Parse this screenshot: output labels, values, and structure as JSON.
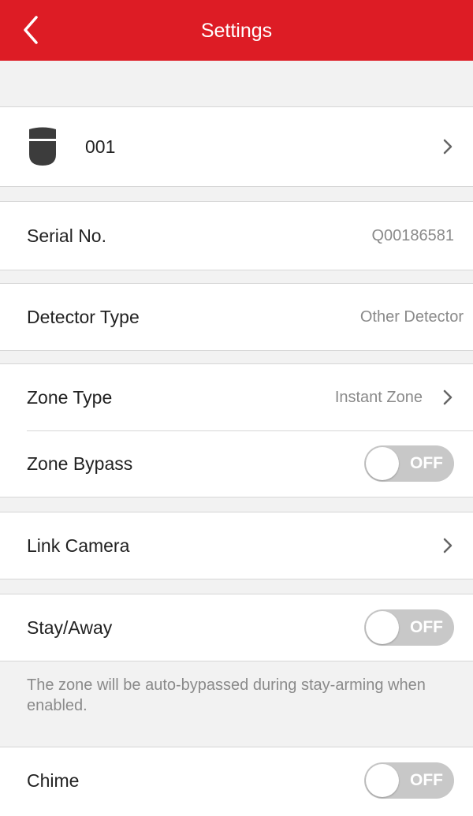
{
  "header": {
    "title": "Settings"
  },
  "device": {
    "name": "001",
    "icon": "detector-icon"
  },
  "serial": {
    "label": "Serial No.",
    "value": "Q00186581"
  },
  "detector_type": {
    "label": "Detector Type",
    "value": "Other Detector"
  },
  "zone_type": {
    "label": "Zone Type",
    "value": "Instant Zone"
  },
  "zone_bypass": {
    "label": "Zone Bypass",
    "state": "OFF"
  },
  "link_camera": {
    "label": "Link Camera"
  },
  "stay_away": {
    "label": "Stay/Away",
    "state": "OFF",
    "note": "The zone will be auto-bypassed during stay-arming when enabled."
  },
  "chime": {
    "label": "Chime",
    "state": "OFF"
  },
  "colors": {
    "header": "#dd1c25",
    "toggle_off": "#c8c8c8",
    "background": "#f2f2f2"
  }
}
